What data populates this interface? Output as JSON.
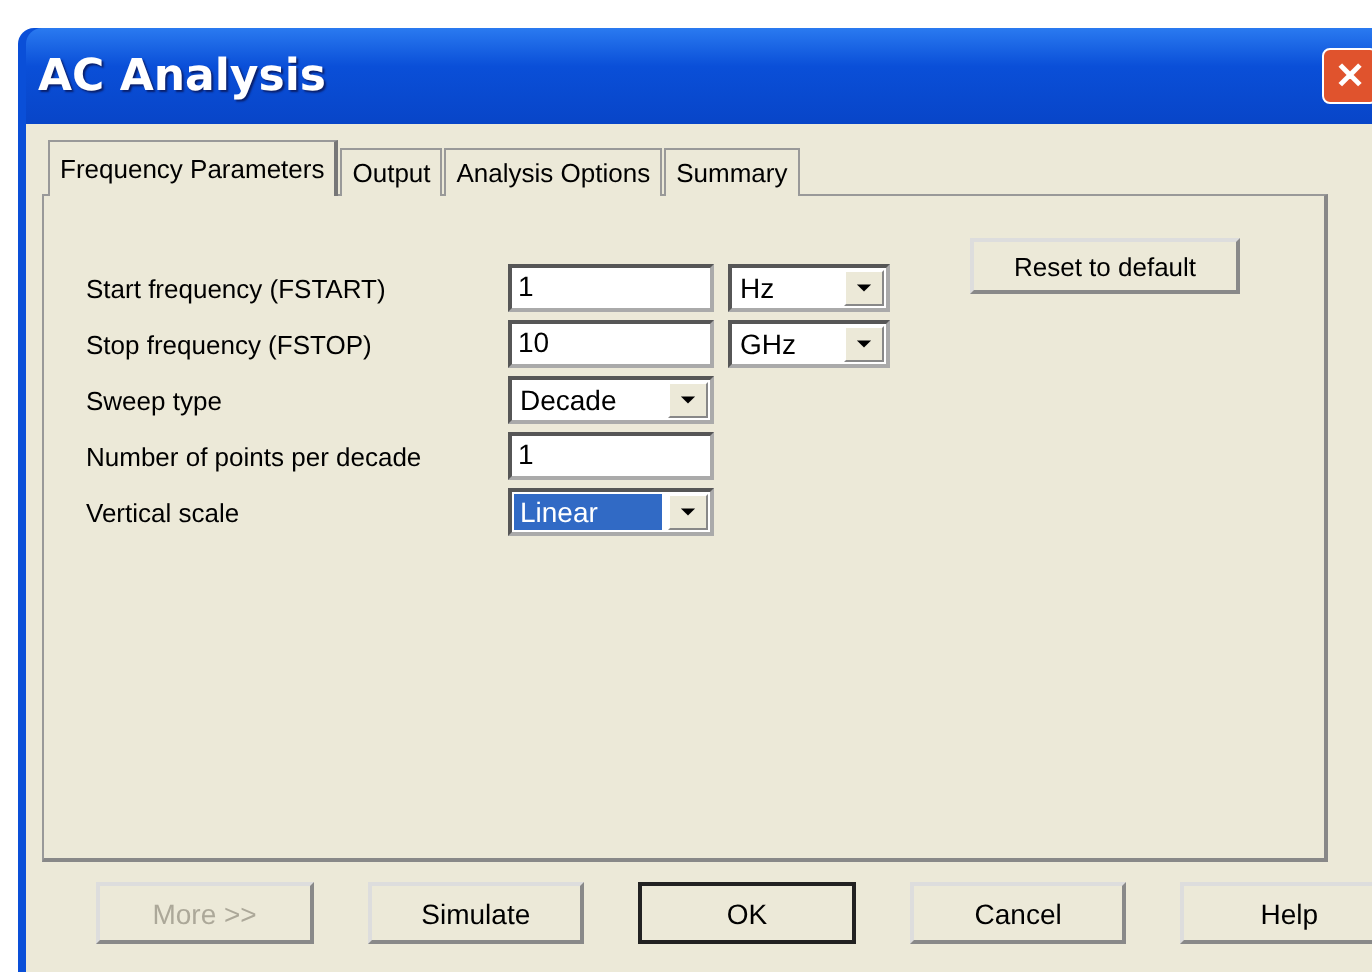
{
  "window": {
    "title": "AC Analysis",
    "close": "✕"
  },
  "tabs": [
    {
      "label": "Frequency Parameters",
      "selected": true
    },
    {
      "label": "Output",
      "selected": false
    },
    {
      "label": "Analysis Options",
      "selected": false
    },
    {
      "label": "Summary",
      "selected": false
    }
  ],
  "fields": [
    {
      "label": "Start frequency (FSTART)",
      "kind": "text",
      "value": "1",
      "unit": {
        "value": "Hz",
        "selected": false
      }
    },
    {
      "label": "Stop frequency (FSTOP)",
      "kind": "text",
      "value": "10",
      "unit": {
        "value": "GHz",
        "selected": false
      }
    },
    {
      "label": "Sweep type",
      "kind": "combo",
      "value": "Decade",
      "selected": false
    },
    {
      "label": "Number of points per decade",
      "kind": "text",
      "value": "1"
    },
    {
      "label": "Vertical scale",
      "kind": "combo",
      "value": "Linear",
      "selected": true
    }
  ],
  "reset_button": "Reset to default",
  "buttons": [
    {
      "label": "More >>",
      "disabled": true,
      "default": false
    },
    {
      "label": "Simulate",
      "disabled": false,
      "default": false
    },
    {
      "label": "OK",
      "disabled": false,
      "default": true
    },
    {
      "label": "Cancel",
      "disabled": false,
      "default": false
    },
    {
      "label": "Help",
      "disabled": false,
      "default": false
    }
  ]
}
